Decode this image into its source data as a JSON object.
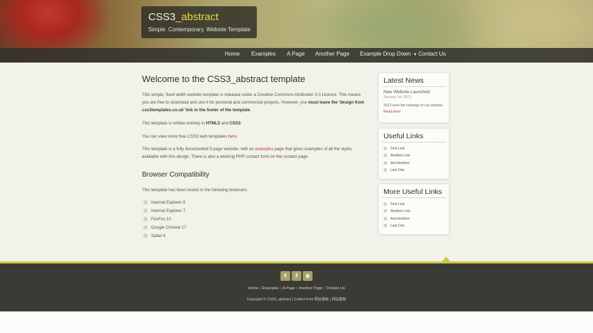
{
  "header": {
    "logo_main": "CSS3",
    "logo_accent": "_abstract",
    "subtitle": "Simple. Contemporary. Website Template"
  },
  "nav": {
    "items": [
      "Home",
      "Examples",
      "A Page",
      "Another Page",
      "Example Drop Down",
      "Contact Us"
    ]
  },
  "main": {
    "title": "Welcome to the CSS3_abstract template",
    "intro_1": "This simple, fixed width website template is released under a Creative Commons Attribution 3.0 Licence. This means you are free to download and use it for personal and commercial projects. However, you",
    "intro_bold": "must leave the 'design from css3templates.co.uk' link in the footer of the template",
    "intro_end": ".",
    "written_1": "This template is written entirely in",
    "written_html5": "HTML5",
    "written_and": "and",
    "written_css3": "CSS3",
    "more_1": "You can view more free CSS3 web templates",
    "more_link": "here",
    "doc_1": "This template is a fully documented 5 page website, with an",
    "doc_link": "examples",
    "doc_2": "page that gives examples of all the styles available with this design. There is also a working PHP contact form on the contact page.",
    "compat_title": "Browser Compatibility",
    "compat_text": "This template has been tested in the following browsers:",
    "browsers": [
      "Internet Explorer 8",
      "Internet Explorer 7",
      "FireFox 10",
      "Google Chrome 17",
      "Safari 4"
    ]
  },
  "sidebar": {
    "news": {
      "title": "Latest News",
      "headline": "New Website Launched",
      "date": "January 1st, 2013",
      "text": "2013 sees the redesign of our website.",
      "read_more": "Read more"
    },
    "useful": {
      "title": "Useful Links",
      "links": [
        "First Link",
        "Another Link",
        "And Another",
        "Last One"
      ]
    },
    "more_useful": {
      "title": "More Useful Links",
      "links": [
        "First Link",
        "Another Link",
        "And Another",
        "Last One"
      ]
    }
  },
  "footer": {
    "social": [
      "t",
      "f",
      "rss"
    ],
    "links": [
      "Home",
      "Examples",
      "A Page",
      "Another Page",
      "Contact Us"
    ],
    "copyright": "Copyright © CSS3_abstract | Collect from 网站模板 | 网站模板"
  },
  "colors": {
    "accent_yellow": "#cfc743",
    "link_red": "#b03a2e",
    "footer_bg": "#3b3b35"
  }
}
